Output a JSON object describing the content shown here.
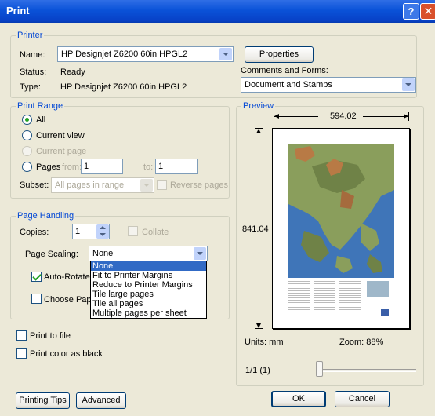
{
  "window": {
    "title": "Print"
  },
  "printer": {
    "group_label": "Printer",
    "name_label": "Name:",
    "name_value": "HP Designjet Z6200 60in HPGL2",
    "status_label": "Status:",
    "status_value": "Ready",
    "type_label": "Type:",
    "type_value": "HP Designjet Z6200 60in HPGL2",
    "properties_button": "Properties",
    "comments_label": "Comments and Forms:",
    "comments_value": "Document and Stamps"
  },
  "print_range": {
    "group_label": "Print Range",
    "all": "All",
    "current_view": "Current view",
    "current_page": "Current page",
    "pages": "Pages",
    "from_label": "from:",
    "from_value": "1",
    "to_label": "to:",
    "to_value": "1",
    "subset_label": "Subset:",
    "subset_value": "All pages in range",
    "reverse_pages": "Reverse pages"
  },
  "page_handling": {
    "group_label": "Page Handling",
    "copies_label": "Copies:",
    "copies_value": "1",
    "collate": "Collate",
    "scaling_label": "Page Scaling:",
    "scaling_value": "None",
    "scaling_options": [
      "None",
      "Fit to Printer Margins",
      "Reduce to Printer Margins",
      "Tile large pages",
      "Tile all pages",
      "Multiple pages per sheet"
    ],
    "auto_rotate": "Auto-Rotate",
    "choose_paper": "Choose Pape"
  },
  "options": {
    "print_to_file": "Print to file",
    "print_color_black": "Print color as black"
  },
  "preview": {
    "group_label": "Preview",
    "width_value": "594.02",
    "height_value": "841.04",
    "units_label": "Units: mm",
    "zoom_label": "Zoom:  88%",
    "page_indicator": "1/1 (1)"
  },
  "buttons": {
    "printing_tips": "Printing Tips",
    "advanced": "Advanced",
    "ok": "OK",
    "cancel": "Cancel"
  },
  "icons": [
    "help-icon",
    "close-icon",
    "chevron-down-icon",
    "spin-up-icon",
    "spin-down-icon"
  ],
  "colors": {
    "titlebar": "#0a52d8",
    "dialog_bg": "#ece9d8",
    "group_label": "#0046d5",
    "selection": "#316ac5"
  }
}
